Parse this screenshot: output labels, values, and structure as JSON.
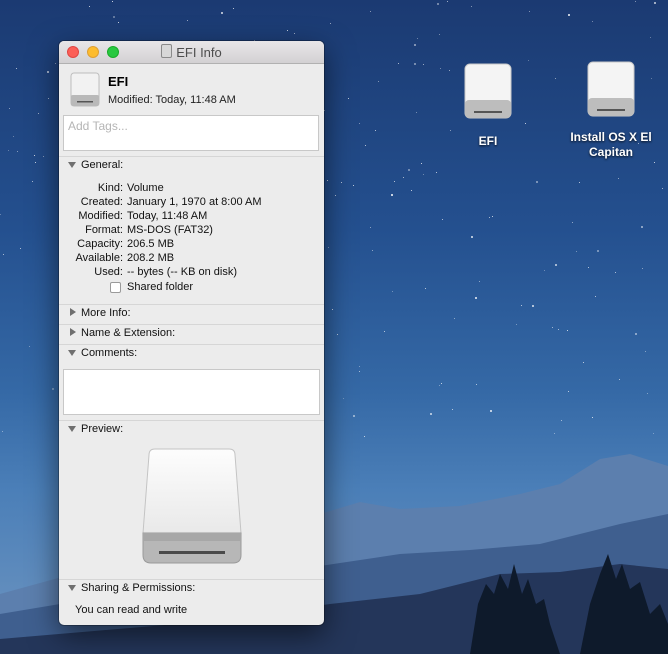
{
  "desktop": {
    "icons": [
      {
        "label": "EFI"
      },
      {
        "label": "Install OS X El Capitan"
      }
    ]
  },
  "window": {
    "title": "EFI Info",
    "header": {
      "name": "EFI",
      "modified": "Modified: Today, 11:48 AM"
    },
    "tags_placeholder": "Add Tags...",
    "sections": {
      "general": "General:",
      "more_info": "More Info:",
      "name_extension": "Name & Extension:",
      "comments": "Comments:",
      "preview": "Preview:",
      "sharing": "Sharing & Permissions:"
    },
    "general_rows": [
      {
        "key": "Kind:",
        "value": "Volume"
      },
      {
        "key": "Created:",
        "value": "January 1, 1970 at 8:00 AM"
      },
      {
        "key": "Modified:",
        "value": "Today, 11:48 AM"
      },
      {
        "key": "Format:",
        "value": "MS-DOS (FAT32)"
      },
      {
        "key": "Capacity:",
        "value": "206.5 MB"
      },
      {
        "key": "Available:",
        "value": "208.2 MB"
      },
      {
        "key": "Used:",
        "value": "-- bytes (-- KB on disk)"
      }
    ],
    "shared_folder_label": "Shared folder",
    "shared_folder_checked": false,
    "permissions_text": "You can read and write"
  },
  "icons": {
    "drive": "external-drive-icon",
    "window_title": "document-icon"
  }
}
